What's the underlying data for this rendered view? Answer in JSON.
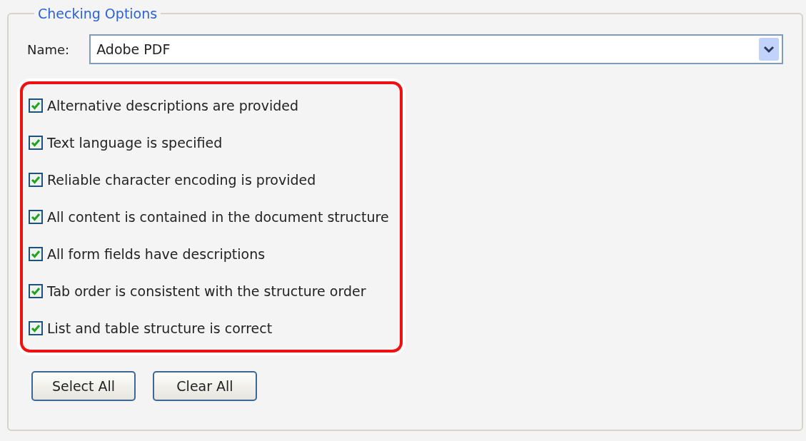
{
  "group": {
    "title": "Checking Options"
  },
  "name_field": {
    "label": "Name:",
    "value": "Adobe PDF"
  },
  "options": [
    {
      "label": "Alternative descriptions are provided",
      "checked": true
    },
    {
      "label": "Text language is specified",
      "checked": true
    },
    {
      "label": "Reliable character encoding is provided",
      "checked": true
    },
    {
      "label": "All content is contained in the document structure",
      "checked": true
    },
    {
      "label": "All form fields have descriptions",
      "checked": true
    },
    {
      "label": "Tab order is consistent with the structure order",
      "checked": true
    },
    {
      "label": "List and table structure is correct",
      "checked": true
    }
  ],
  "buttons": [
    "Select All",
    "Clear All"
  ]
}
